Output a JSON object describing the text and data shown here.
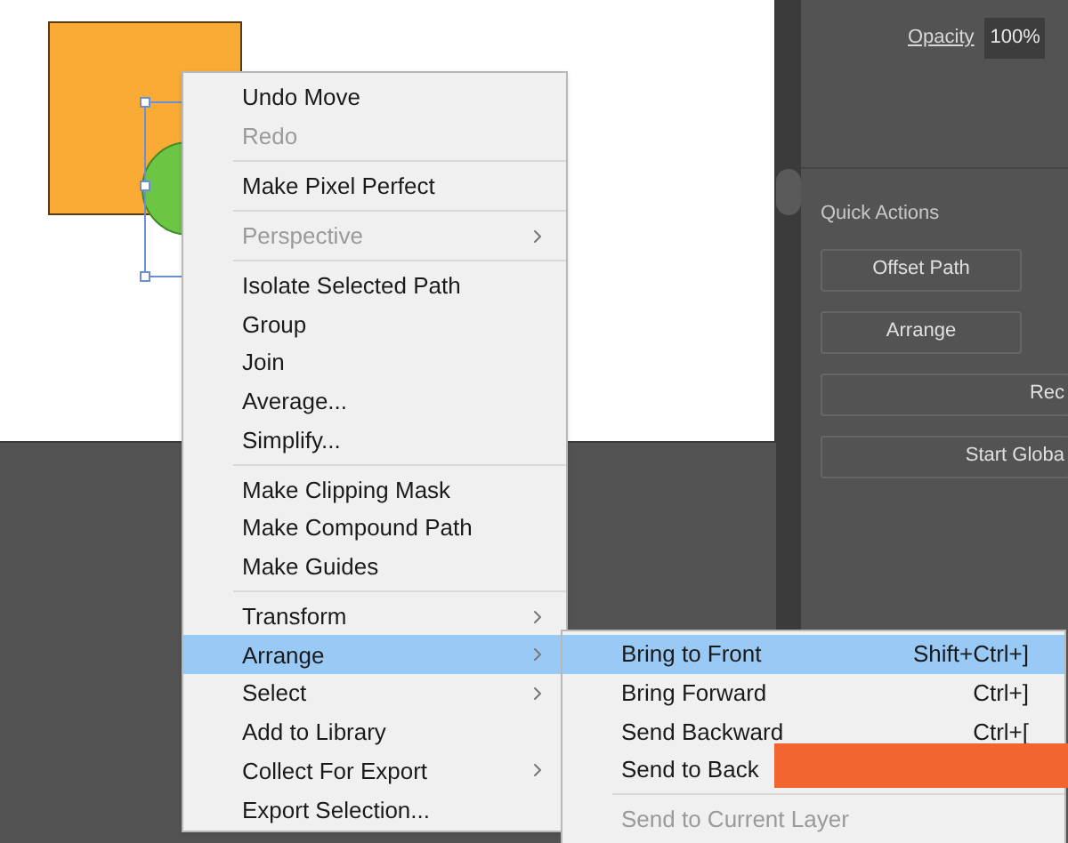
{
  "properties_panel": {
    "opacity_label": "Opacity",
    "opacity_value": "100%",
    "quick_actions_title": "Quick Actions",
    "buttons": [
      "Offset Path",
      "Arrange",
      "Rec",
      "Start Globa"
    ]
  },
  "context_menu": [
    {
      "kind": "item",
      "label": "Undo Move",
      "disabled": false,
      "has_submenu": false,
      "selected": false
    },
    {
      "kind": "item",
      "label": "Redo",
      "disabled": true,
      "has_submenu": false,
      "selected": false
    },
    {
      "kind": "separator"
    },
    {
      "kind": "item",
      "label": "Make Pixel Perfect",
      "disabled": false,
      "has_submenu": false,
      "selected": false
    },
    {
      "kind": "separator"
    },
    {
      "kind": "item",
      "label": "Perspective",
      "disabled": true,
      "has_submenu": true,
      "selected": false
    },
    {
      "kind": "separator"
    },
    {
      "kind": "item",
      "label": "Isolate Selected Path",
      "disabled": false,
      "has_submenu": false,
      "selected": false
    },
    {
      "kind": "item",
      "label": "Group",
      "disabled": false,
      "has_submenu": false,
      "selected": false
    },
    {
      "kind": "item",
      "label": "Join",
      "disabled": false,
      "has_submenu": false,
      "selected": false
    },
    {
      "kind": "item",
      "label": "Average...",
      "disabled": false,
      "has_submenu": false,
      "selected": false
    },
    {
      "kind": "item",
      "label": "Simplify...",
      "disabled": false,
      "has_submenu": false,
      "selected": false
    },
    {
      "kind": "separator"
    },
    {
      "kind": "item",
      "label": "Make Clipping Mask",
      "disabled": false,
      "has_submenu": false,
      "selected": false
    },
    {
      "kind": "item",
      "label": "Make Compound Path",
      "disabled": false,
      "has_submenu": false,
      "selected": false
    },
    {
      "kind": "item",
      "label": "Make Guides",
      "disabled": false,
      "has_submenu": false,
      "selected": false
    },
    {
      "kind": "separator"
    },
    {
      "kind": "item",
      "label": "Transform",
      "disabled": false,
      "has_submenu": true,
      "selected": false
    },
    {
      "kind": "item",
      "label": "Arrange",
      "disabled": false,
      "has_submenu": true,
      "selected": true
    },
    {
      "kind": "item",
      "label": "Select",
      "disabled": false,
      "has_submenu": true,
      "selected": false
    },
    {
      "kind": "item",
      "label": "Add to Library",
      "disabled": false,
      "has_submenu": false,
      "selected": false
    },
    {
      "kind": "item",
      "label": "Collect For Export",
      "disabled": false,
      "has_submenu": true,
      "selected": false
    },
    {
      "kind": "item",
      "label": "Export Selection...",
      "disabled": false,
      "has_submenu": false,
      "selected": false
    }
  ],
  "arrange_submenu": [
    {
      "kind": "item",
      "label": "Bring to Front",
      "shortcut": "Shift+Ctrl+]",
      "disabled": false,
      "selected": true
    },
    {
      "kind": "item",
      "label": "Bring Forward",
      "shortcut": "Ctrl+]",
      "disabled": false,
      "selected": false
    },
    {
      "kind": "item",
      "label": "Send Backward",
      "shortcut": "Ctrl+[",
      "disabled": false,
      "selected": false
    },
    {
      "kind": "item",
      "label": "Send to Back",
      "disabled": false,
      "selected": false
    },
    {
      "kind": "separator"
    },
    {
      "kind": "item",
      "label": "Send to Current Layer",
      "disabled": true,
      "selected": false
    }
  ]
}
